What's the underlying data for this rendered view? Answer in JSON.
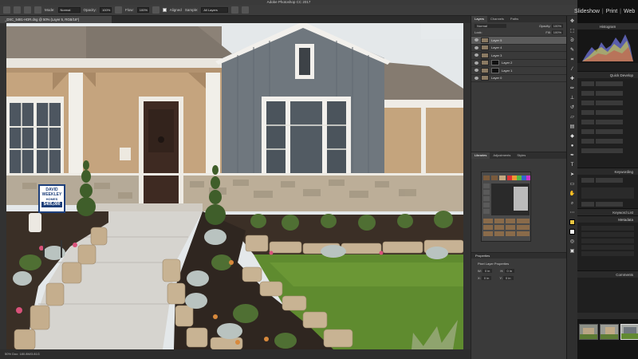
{
  "app": {
    "title": "Adobe Photoshop CC 2017"
  },
  "options_bar": {
    "mode_label": "Mode:",
    "mode_value": "Normal",
    "opacity_label": "Opacity:",
    "opacity_value": "100%",
    "flow_label": "Flow:",
    "flow_value": "100%",
    "aligned_label": "Aligned",
    "sample_label": "Sample:",
    "sample_value": "All Layers"
  },
  "document": {
    "tab_label": "_DSC_5481-HDR.dng @ 50% (Layer 5, RGB/16*)",
    "status_text": "50%     Doc: 180.8M/3.81G"
  },
  "panels": {
    "tabs": [
      "Layers",
      "Channels",
      "Paths"
    ],
    "blend_mode": "Normal",
    "opacity_label": "Opacity:",
    "opacity_value": "100%",
    "lock_label": "Lock:",
    "fill_label": "Fill:",
    "fill_value": "100%",
    "layers": [
      {
        "name": "Layer 5",
        "selected": true,
        "mask": false
      },
      {
        "name": "Layer 4",
        "selected": false,
        "mask": false
      },
      {
        "name": "Layer 3",
        "selected": false,
        "mask": false
      },
      {
        "name": "Layer 2",
        "selected": false,
        "mask": true
      },
      {
        "name": "Layer 1",
        "selected": false,
        "mask": true
      },
      {
        "name": "Layer 0",
        "selected": false,
        "mask": false
      }
    ],
    "swatches_tabs": [
      "Libraries",
      "Adjustments",
      "Styles"
    ],
    "properties_tab": "Properties",
    "properties_title": "Pixel Layer Properties",
    "prop_w_label": "W:",
    "prop_w_value": "0 in",
    "prop_h_label": "H:",
    "prop_h_value": "0 in",
    "prop_x_label": "X:",
    "prop_x_value": "0 in",
    "prop_y_label": "Y:",
    "prop_y_value": "0 in"
  },
  "lightroom": {
    "modules": [
      "Slideshow",
      "Print",
      "Web"
    ],
    "histogram_label": "Histogram",
    "quick_develop_label": "Quick Develop",
    "keywording_label": "Keywording",
    "keyword_list_label": "Keyword List",
    "metadata_label": "Metadata",
    "comments_label": "Comments"
  },
  "yard_sign": {
    "line1": "DAVID",
    "line2": "WEEKLEY",
    "line3": "HOMES",
    "price": "$405,000"
  },
  "colors": {
    "ps_bg": "#323232",
    "panel_bg": "#3a3a3a",
    "siding_tan": "#c2a27d",
    "gable_gray": "#6e767d",
    "roof": "#8a7e72",
    "grass": "#5e8a2e"
  }
}
